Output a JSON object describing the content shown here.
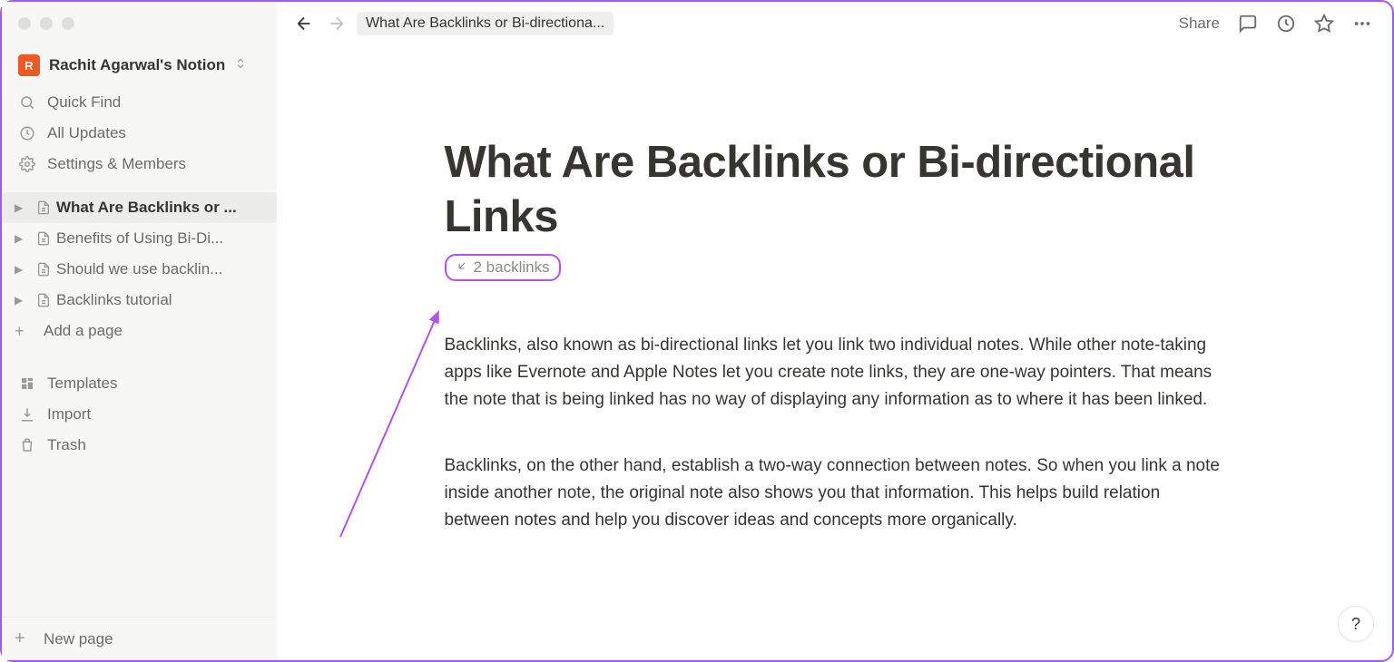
{
  "workspace": {
    "initial": "R",
    "name": "Rachit Agarwal's Notion"
  },
  "sidebar": {
    "quick_find": "Quick Find",
    "all_updates": "All Updates",
    "settings": "Settings & Members",
    "pages": [
      {
        "label": "What Are Backlinks or Bi-directional Links",
        "display": "What Are Backlinks or ...",
        "active": true
      },
      {
        "label": "Benefits of Using Bi-Directional Links",
        "display": "Benefits of Using Bi-Di...",
        "active": false
      },
      {
        "label": "Should we use backlinks",
        "display": "Should we use backlin...",
        "active": false
      },
      {
        "label": "Backlinks tutorial",
        "display": "Backlinks tutorial",
        "active": false
      }
    ],
    "add_page": "Add a page",
    "templates": "Templates",
    "import": "Import",
    "trash": "Trash",
    "new_page": "New page"
  },
  "topbar": {
    "breadcrumb": "What Are Backlinks or Bi-directiona...",
    "share": "Share"
  },
  "page": {
    "title": "What Are Backlinks or Bi-directional Links",
    "backlinks_label": "2 backlinks",
    "paragraph1": "Backlinks, also known as bi-directional links let you link two individual notes. While other note-taking apps like Evernote and Apple Notes let you create note links, they are one-way pointers. That means the note that is being linked has no way of displaying any information as to where it has been linked.",
    "paragraph2": "Backlinks, on the other hand, establish a two-way connection between notes. So when you link a note inside another note, the original note also shows you that information. This helps build relation between notes and help you discover ideas and concepts more organically."
  },
  "help": "?"
}
